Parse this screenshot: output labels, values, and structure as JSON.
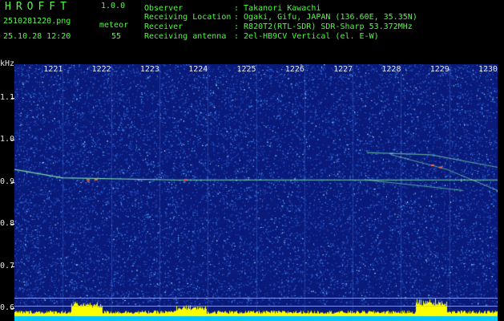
{
  "app": {
    "logo_text": "HROFFT",
    "version": "1.0.0",
    "filename": "2510281220.png",
    "datetime": "25.10.28 12:20",
    "mode_label": "meteor",
    "count": "55"
  },
  "info": {
    "labels": [
      "Observer",
      "Receiving Location",
      "Receiver",
      "Receiving antenna"
    ],
    "values": [
      ": Takanori Kawachi",
      ": Ogaki, Gifu, JAPAN (136.60E, 35.35N)",
      ": R820T2(RTL-SDR) SDR-Sharp 53.372MHz",
      ": 2el-HB9CV Vertical (el. E-W)"
    ]
  },
  "spectrogram": {
    "y_unit": "kHz",
    "y_ticks": [
      "1.1",
      "1.0",
      "0.9",
      "0.8",
      "0.7",
      "0.6"
    ],
    "y_range": [
      0.57,
      1.18
    ],
    "minute_labels": [
      "1221",
      "1222",
      "1223",
      "1224",
      "1225",
      "1226",
      "1227",
      "1228",
      "1229",
      "1230"
    ],
    "colors": {
      "background": "#0a1a7a",
      "noise": "#2f6bd8",
      "trace": "#8cffb0",
      "hot": "#ff6a3a",
      "bar": "#ffff00",
      "floor": "#00c8ff"
    }
  }
}
